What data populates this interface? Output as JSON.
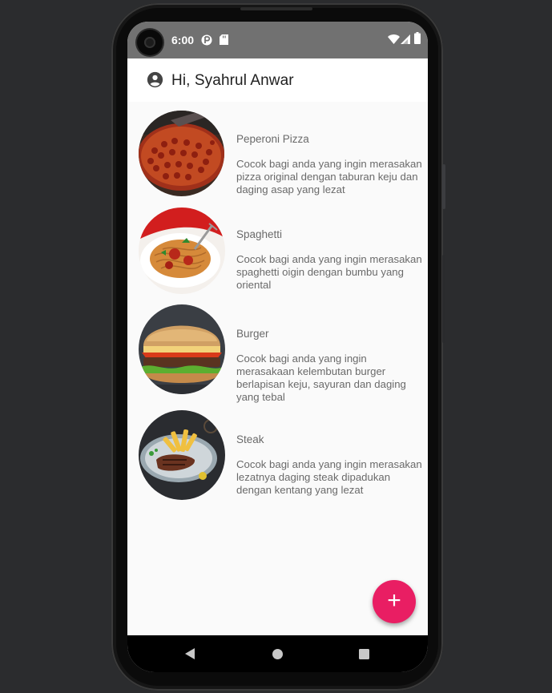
{
  "status_bar": {
    "time": "6:00"
  },
  "app_bar": {
    "title": "Hi, Syahrul Anwar"
  },
  "menu_items": [
    {
      "name": "Peperoni Pizza",
      "description": "Cocok bagi anda yang ingin merasakan pizza original dengan taburan keju dan daging asap yang lezat"
    },
    {
      "name": "Spaghetti",
      "description": "Cocok bagi anda yang ingin merasakan spaghetti oigin dengan bumbu yang oriental"
    },
    {
      "name": "Burger",
      "description": "Cocok bagi anda yang ingin merasakaan kelembutan burger berlapisan keju, sayuran dan daging yang tebal"
    },
    {
      "name": "Steak",
      "description": "Cocok bagi anda yang ingin merasakan lezatnya daging steak dipadukan dengan kentang yang lezat"
    }
  ],
  "fab": {
    "label": "+"
  },
  "colors": {
    "fab": "#e91e63",
    "status_bar": "#717171",
    "background": "#fafafa"
  }
}
